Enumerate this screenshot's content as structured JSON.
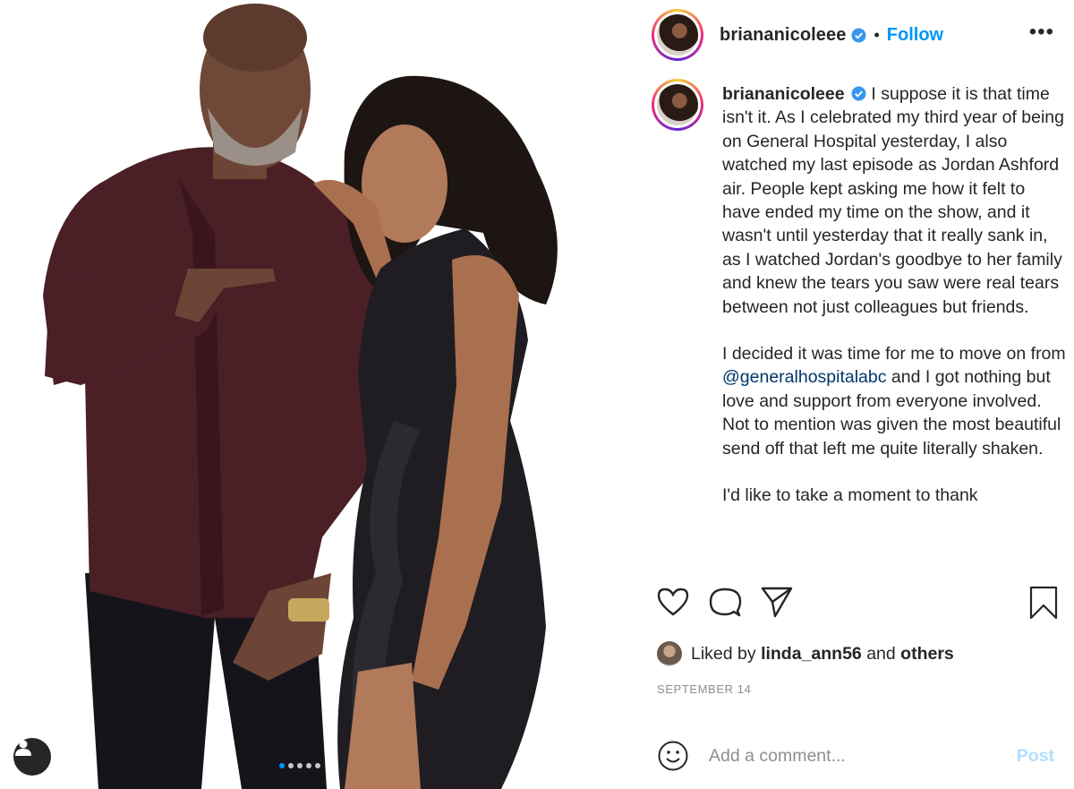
{
  "post": {
    "username": "briananicoleee",
    "follow_label": "Follow",
    "dot_separator": "•",
    "more_label": "•••",
    "caption": {
      "username": "briananicoleee",
      "paragraph_1": " I suppose it is that time isn't it. As I celebrated my third year of being on General Hospital yesterday, I also watched my last episode as Jordan Ashford air. People kept asking me how it felt to have ended my time on the show, and it wasn't until yesterday that it really sank in, as I watched Jordan's goodbye to her family and knew the tears you saw were real tears between not just colleagues but friends.",
      "paragraph_2_before": "I decided it was time for me to move on from ",
      "paragraph_2_mention": "@generalhospitalabc",
      "paragraph_2_after": " and I got nothing but love and support from everyone involved. Not to mention was given the most beautiful send off that left me quite literally shaken.",
      "paragraph_3": "I'd like to take a moment to thank"
    },
    "likes": {
      "prefix": "Liked by ",
      "user": "linda_ann56",
      "middle": " and ",
      "others": "others"
    },
    "date": "SEPTEMBER 14",
    "comment": {
      "placeholder": "Add a comment...",
      "post_label": "Post"
    },
    "carousel": {
      "count": 5,
      "active_index": 0
    },
    "icons": {
      "like": "heart-icon",
      "comment": "comment-bubble-icon",
      "share": "paper-plane-icon",
      "save": "bookmark-icon",
      "emoji": "smiley-icon",
      "user_tag": "person-icon",
      "verified": "verified-badge-icon"
    },
    "colors": {
      "link_blue": "#0095f6",
      "mention_blue": "#00376b",
      "verified_blue": "#3897f0",
      "post_disabled": "#b2dffc"
    }
  }
}
